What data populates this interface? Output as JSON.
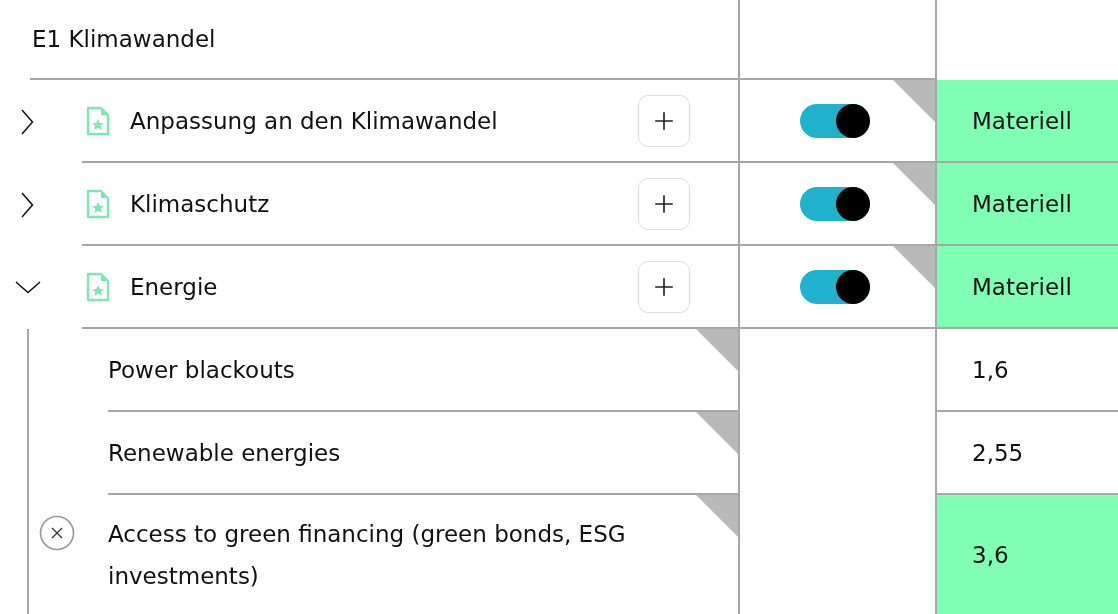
{
  "section": {
    "title": "E1 Klimawandel"
  },
  "topics": [
    {
      "title": "Anpassung an den Klimawandel",
      "expanded": false,
      "on": true,
      "value": "Materiell",
      "highlighted": true
    },
    {
      "title": "Klimaschutz",
      "expanded": false,
      "on": true,
      "value": "Materiell",
      "highlighted": true
    },
    {
      "title": "Energie",
      "expanded": true,
      "on": true,
      "value": "Materiell",
      "highlighted": true,
      "children": [
        {
          "title": "Power blackouts",
          "value": "1,6",
          "highlighted": false,
          "removable": false
        },
        {
          "title": "Renewable energies",
          "value": "2,55",
          "highlighted": false,
          "removable": false
        },
        {
          "title": "Access to green financing (green bonds, ESG investments)",
          "value": "3,6",
          "highlighted": true,
          "removable": true
        }
      ]
    }
  ]
}
